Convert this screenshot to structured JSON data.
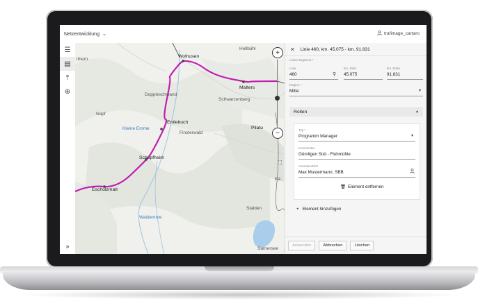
{
  "header": {
    "app_selector": "Netzentwicklung",
    "user": "trafimage_cartaro"
  },
  "map": {
    "labels": {
      "wolhusen": "Wolhusen",
      "hellbuhl": "Hellbühl",
      "malters": "Malters",
      "schwarzenberg": "Schwarzenberg",
      "doppleschwand": "Doppleschwand",
      "napf": "Napf",
      "kleine_emme": "Kleine Emme",
      "entlebuch": "Entlebuch",
      "finsterwald": "Finsterwald",
      "pilatus": "Pilatu",
      "schupfheim": "Schüpfheim",
      "escholzmatt": "Escholzmatt",
      "waldemme": "Waldemme",
      "stalden": "Stalden",
      "sarnersee": "Sarnersee",
      "ithern": "ithern",
      "ka": "Kä"
    },
    "route_color": "#c21fb0"
  },
  "panel": {
    "title": "Linie 460, km. 45.075 - km. 91.831",
    "segment_label": "Linien-Segment *",
    "line_label": "Linie",
    "line_value": "460",
    "km_start_label": "km. Start",
    "km_start_value": "45.075",
    "km_end_label": "km. Ende",
    "km_end_value": "91.831",
    "region_label": "Region *",
    "region_value": "Mitte",
    "roles_section": "Rollen",
    "type_label": "Typ *",
    "type_value": "Programm Manager",
    "comment_label": "Kommentar",
    "comment_value": "Gümligen Süd - Fluhmühle",
    "person_label": "Verantwortlich",
    "person_value": "Max Mustermann, SBB",
    "remove_element": "Element entfernen",
    "add_element": "Element hinzufügen",
    "apply": "Anwenden",
    "cancel": "Abbrechen",
    "delete": "Löschen"
  }
}
